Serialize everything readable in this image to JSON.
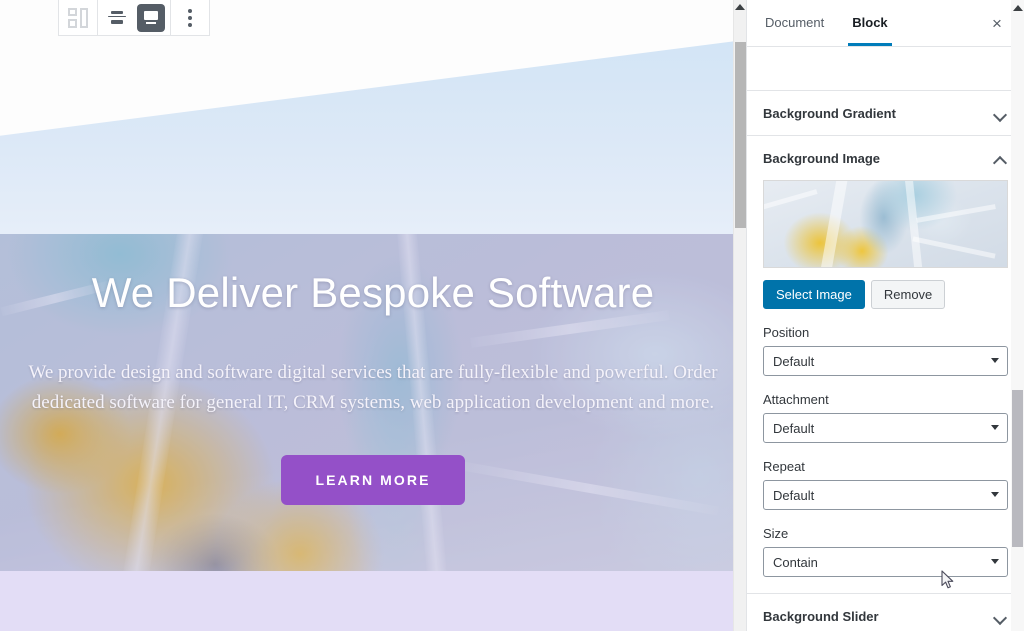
{
  "editor": {
    "toolbar": {
      "block_type_icon": "columns-icon",
      "change_alignment_icon": "change-alignment-icon",
      "full_width_icon": "full-width-icon",
      "more_options_icon": "more-options-vertical-dots-icon"
    },
    "hero": {
      "title": "We Deliver Bespoke Software",
      "paragraph": "We provide design and  software digital services that are fully-flexible and powerful. Order dedicated software for general IT, CRM systems, web application  development and more.",
      "button_label": "LEARN MORE",
      "button_color": "#9450c8",
      "overlay_tint": "#a09bcd"
    },
    "bottom_strip_color": "#e3ddf6",
    "gradient_band": {
      "from": "#ffffff",
      "to": "#cfe3f5"
    }
  },
  "sidebar": {
    "tabs": [
      {
        "label": "Document",
        "active": false
      },
      {
        "label": "Block",
        "active": true
      }
    ],
    "active_tab_color": "#007cba",
    "close_icon": "×",
    "panels": [
      {
        "title": "Background Gradient",
        "expanded": false,
        "chevron": "chevron-down-icon"
      },
      {
        "title": "Background Image",
        "expanded": true,
        "chevron": "chevron-up-icon",
        "thumbnail_alt": "background-image-thumbnail",
        "buttons": {
          "primary": "Select Image",
          "primary_color": "#0073aa",
          "secondary": "Remove"
        },
        "fields": [
          {
            "label": "Position",
            "value": "Default"
          },
          {
            "label": "Attachment",
            "value": "Default"
          },
          {
            "label": "Repeat",
            "value": "Default"
          },
          {
            "label": "Size",
            "value": "Contain"
          }
        ]
      },
      {
        "title": "Background Slider",
        "expanded": false,
        "chevron": "chevron-down-icon"
      }
    ]
  }
}
